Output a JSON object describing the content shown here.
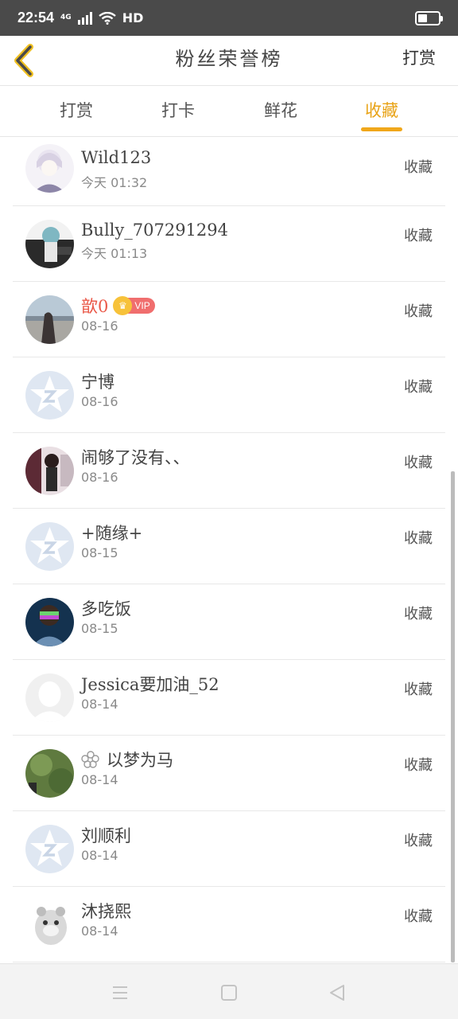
{
  "status_bar": {
    "time": "22:54",
    "network": "4G",
    "hd": "HD",
    "battery_level": 0.45
  },
  "header": {
    "title": "粉丝荣誉榜",
    "action": "打赏",
    "back_icon": "chevron-left-icon",
    "accent_color": "#f0a71a"
  },
  "tabs": [
    {
      "label": "打赏",
      "active": false
    },
    {
      "label": "打卡",
      "active": false
    },
    {
      "label": "鲜花",
      "active": false
    },
    {
      "label": "收藏",
      "active": true
    }
  ],
  "rows": [
    {
      "name": "Wild123",
      "time": "今天 01:32",
      "action": "收藏",
      "avatar": "anime-avatar"
    },
    {
      "name": "Bully_707291294",
      "time": "今天 01:13",
      "action": "收藏",
      "avatar": "photo-avatar"
    },
    {
      "name": "歆0",
      "time": "08-16",
      "action": "收藏",
      "avatar": "photo-avatar",
      "highlight": true,
      "badge": "VIP"
    },
    {
      "name": "宁博",
      "time": "08-16",
      "action": "收藏",
      "avatar": "default-star-avatar"
    },
    {
      "name": "闹够了没有、、",
      "time": "08-16",
      "action": "收藏",
      "avatar": "photo-avatar"
    },
    {
      "name": "+随缘+",
      "time": "08-15",
      "action": "收藏",
      "avatar": "default-star-avatar"
    },
    {
      "name": "多吃饭",
      "time": "08-15",
      "action": "收藏",
      "avatar": "photo-avatar"
    },
    {
      "name": "Jessica要加油_52",
      "time": "08-14",
      "action": "收藏",
      "avatar": "silhouette-avatar"
    },
    {
      "name": "以梦为马",
      "time": "08-14",
      "action": "收藏",
      "avatar": "photo-avatar",
      "prefix_icon": "flower-icon"
    },
    {
      "name": "刘顺利",
      "time": "08-14",
      "action": "收藏",
      "avatar": "default-star-avatar"
    },
    {
      "name": "沐挠熙",
      "time": "08-14",
      "action": "收藏",
      "avatar": "hamster-avatar"
    }
  ],
  "colors": {
    "highlight_name": "#ea5a4a",
    "vip_badge": "#f06e6e",
    "vip_crown": "#f7c23a",
    "default_avatar": "#dfe7f2"
  },
  "bottom_nav": [
    "menu-icon",
    "home-square-icon",
    "back-triangle-icon"
  ]
}
